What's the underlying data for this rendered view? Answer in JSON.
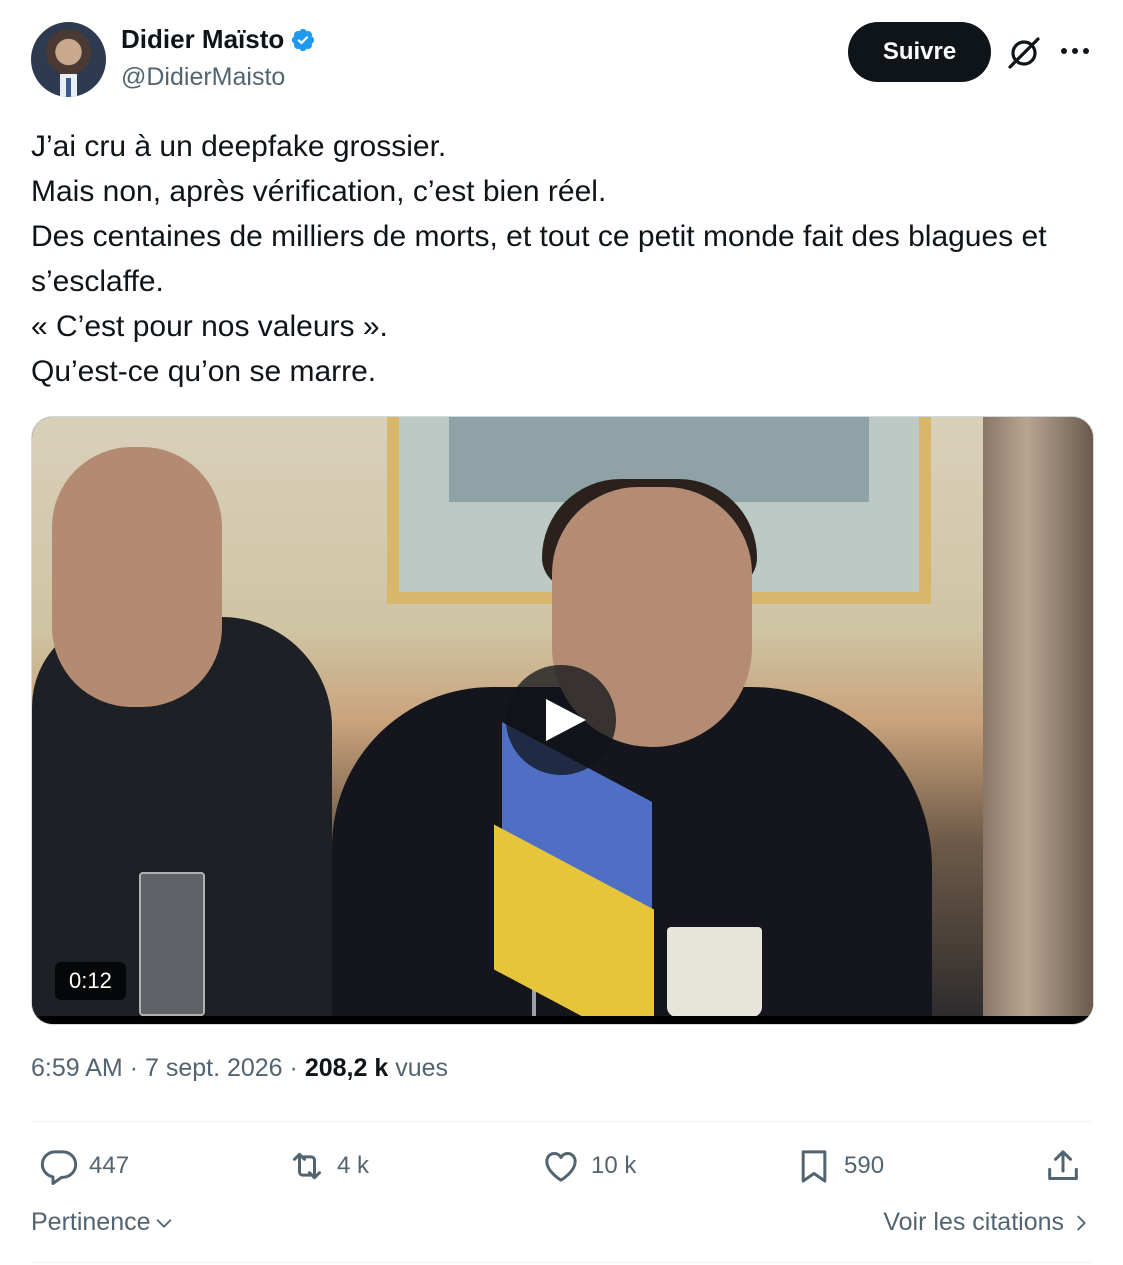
{
  "author": {
    "name": "Didier Maïsto",
    "handle": "@DidierMaisto",
    "verified": true,
    "verified_color": "#1d9bf0"
  },
  "header": {
    "follow_label": "Suivre",
    "grok_icon": "grok-icon",
    "more_icon": "more-icon"
  },
  "tweet": {
    "text": "J’ai cru à un deepfake grossier.\nMais non, après vérification, c’est bien réel.\nDes centaines de milliers de morts, et tout ce petit monde fait des blagues et s’esclaffe.\n« C’est pour nos valeurs ».\nQu’est-ce qu’on se marre."
  },
  "media": {
    "type": "video",
    "duration": "0:12",
    "play_icon": "play-icon"
  },
  "meta": {
    "time": "6:59 AM",
    "separator": "·",
    "date": "7 sept. 2026",
    "views_count": "208,2 k",
    "views_label": "vues"
  },
  "actions": {
    "replies": "447",
    "reposts": "4 k",
    "likes": "10 k",
    "bookmarks": "590"
  },
  "footer": {
    "sort_label": "Pertinence",
    "quotes_label": "Voir les citations"
  },
  "colors": {
    "text_primary": "#0f1419",
    "text_secondary": "#536471",
    "follow_bg": "#0f1419",
    "border": "#cfd9de"
  }
}
